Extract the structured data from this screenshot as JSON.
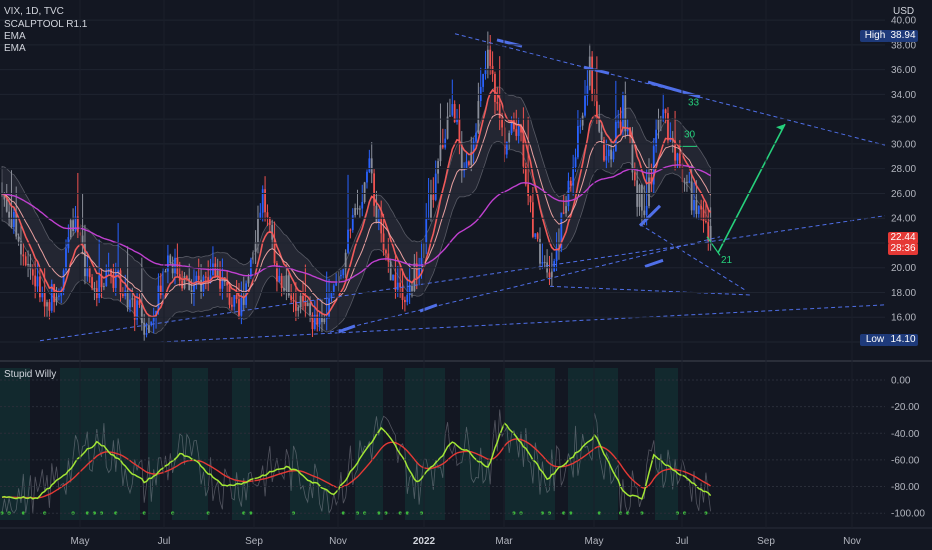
{
  "header": {
    "symbol_line": "VIX, 1D, TVC",
    "indicators": [
      "SCALPTOOL R1.1",
      "EMA",
      "EMA"
    ],
    "currency": "USD",
    "oscillator_name": "Stupid Willy"
  },
  "price_axis": {
    "ticks": [
      "40.00",
      "38.00",
      "36.00",
      "34.00",
      "32.00",
      "30.00",
      "28.00",
      "26.00",
      "24.00",
      "22.00",
      "20.00",
      "18.00",
      "16.00",
      "14.00"
    ],
    "high_label": "High",
    "high_value": "38.94",
    "low_label": "Low",
    "low_value": "14.10",
    "last_price": "22.44",
    "countdown": "28:36"
  },
  "osc_axis": {
    "ticks": [
      "0.00",
      "-20.00",
      "-40.00",
      "-60.00",
      "-80.00",
      "-100.00"
    ]
  },
  "time_axis": {
    "labels": [
      "May",
      "Jul",
      "Sep",
      "Nov",
      "2022",
      "Mar",
      "May",
      "Jul",
      "Sep",
      "Nov"
    ]
  },
  "annotations": {
    "level_33": "33",
    "level_30": "30",
    "level_21": "21"
  },
  "colors": {
    "background": "#131722",
    "up": "#2962ff",
    "down": "#ef5350",
    "neutral": "#8a8e99",
    "ema_fast": "#f05a5a",
    "ema_slow": "#c040d0",
    "trend": "#4f6fe8",
    "arrow": "#26d07c",
    "osc_fast": "#a3e635",
    "osc_slow": "#e53935"
  },
  "chart_data": [
    {
      "type": "candlestick",
      "title": "VIX, 1D, TVC",
      "ylabel": "USD",
      "ylim": [
        13.5,
        41
      ],
      "x": [
        "2021-04",
        "2021-05",
        "2021-06",
        "2021-07",
        "2021-08",
        "2021-09",
        "2021-10",
        "2021-11",
        "2021-12",
        "2022-01",
        "2022-02",
        "2022-03",
        "2022-04",
        "2022-05",
        "2022-06",
        "2022-07"
      ],
      "close_approx": [
        19,
        20,
        17,
        18,
        17,
        21,
        17,
        16,
        21,
        22,
        28,
        28,
        24,
        30,
        27,
        22.44
      ],
      "high": 38.94,
      "low": 14.1,
      "last": 22.44,
      "trend_levels": [
        33,
        30,
        21
      ]
    },
    {
      "type": "line",
      "title": "Stupid Willy",
      "ylim": [
        -100,
        0
      ],
      "x": [
        "2021-04",
        "2021-05",
        "2021-06",
        "2021-07",
        "2021-08",
        "2021-09",
        "2021-10",
        "2021-11",
        "2021-12",
        "2022-01",
        "2022-02",
        "2022-03",
        "2022-04",
        "2022-05",
        "2022-06",
        "2022-07"
      ],
      "series": [
        {
          "values": [
            -85,
            -60,
            -70,
            -80,
            -75,
            -60,
            -72,
            -85,
            -55,
            -30,
            -45,
            -35,
            -75,
            -35,
            -50,
            -85
          ]
        },
        {
          "values": [
            -88,
            -72,
            -74,
            -82,
            -80,
            -70,
            -74,
            -80,
            -65,
            -45,
            -50,
            -45,
            -70,
            -50,
            -55,
            -75
          ]
        }
      ]
    }
  ]
}
